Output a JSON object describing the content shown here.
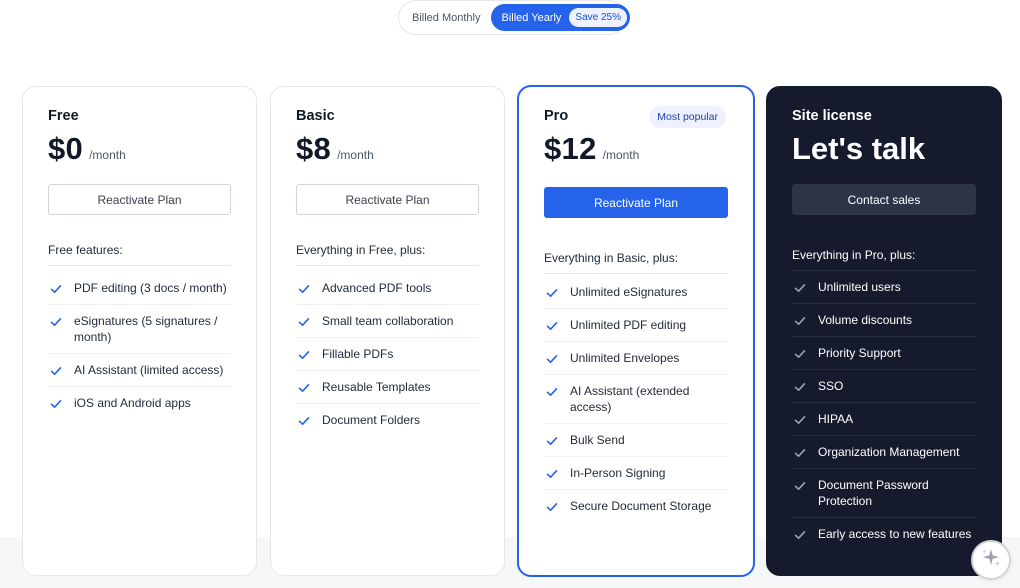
{
  "billing_toggle": {
    "monthly_label": "Billed Monthly",
    "yearly_label": "Billed Yearly",
    "save_badge": "Save 25%",
    "selected": "yearly"
  },
  "colors": {
    "accent": "#2563eb",
    "dark_card": "#151b2c",
    "check": "#2563eb"
  },
  "plans": {
    "free": {
      "name": "Free",
      "price": "$0",
      "per": "/month",
      "cta": "Reactivate Plan",
      "features_heading": "Free features:",
      "features": [
        "PDF editing (3 docs / month)",
        "eSignatures (5 signatures / month)",
        "AI Assistant (limited access)",
        "iOS and Android apps"
      ]
    },
    "basic": {
      "name": "Basic",
      "price": "$8",
      "per": "/month",
      "cta": "Reactivate Plan",
      "features_heading": "Everything in Free, plus:",
      "features": [
        "Advanced PDF tools",
        "Small team collaboration",
        "Fillable PDFs",
        "Reusable Templates",
        "Document Folders"
      ]
    },
    "pro": {
      "name": "Pro",
      "badge": "Most popular",
      "price": "$12",
      "per": "/month",
      "cta": "Reactivate Plan",
      "features_heading": "Everything in Basic, plus:",
      "features": [
        "Unlimited eSignatures",
        "Unlimited PDF editing",
        "Unlimited Envelopes",
        "AI Assistant (extended access)",
        "Bulk Send",
        "In-Person Signing",
        "Secure Document Storage"
      ]
    },
    "site": {
      "name": "Site license",
      "headline": "Let's talk",
      "cta": "Contact sales",
      "features_heading": "Everything in Pro, plus:",
      "features": [
        "Unlimited users",
        "Volume discounts",
        "Priority Support",
        "SSO",
        "HIPAA",
        "Organization Management",
        "Document Password Protection",
        "Early access to new features"
      ]
    }
  },
  "assistant_button": {
    "icon": "sparkle-icon"
  }
}
